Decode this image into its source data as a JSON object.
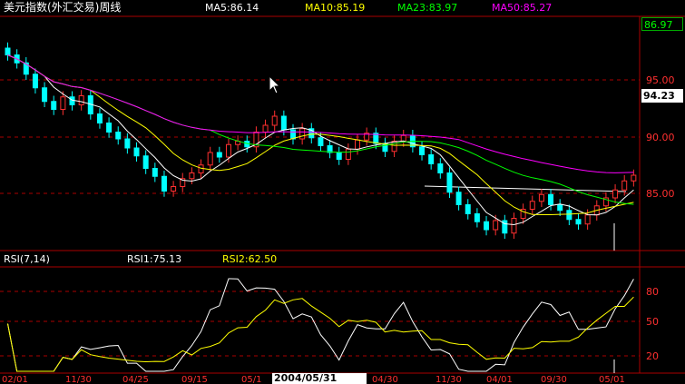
{
  "header": {
    "title": "美元指数(外汇交易)周线",
    "ma5": "MA5:86.14",
    "ma10": "MA10:85.19",
    "ma23": "MA23:83.97",
    "ma50": "MA50:85.27"
  },
  "price_axis": {
    "top_price": "86.97",
    "current_price": "94.23",
    "labels": [
      "95.00",
      "90.00",
      "85.00"
    ]
  },
  "rsi": {
    "label": "RSI(7,14)",
    "rsi1": "RSI1:75.13",
    "rsi2": "RSI2:62.50",
    "levels": [
      "80",
      "50",
      "20"
    ]
  },
  "date_axis": {
    "labels": [
      "02/01",
      "11/30",
      "04/25",
      "09/15",
      "05/1",
      "04/30",
      "11/30",
      "04/01",
      "09/30",
      "05/01"
    ],
    "highlight": "2004/05/31"
  },
  "colors": {
    "background": "#000000",
    "up_candle": "#ff3030",
    "down_candle": "#00ffff",
    "ma5": "#ffffff",
    "ma10": "#ffff00",
    "ma23": "#00ff00",
    "ma50": "#ff00ff",
    "grid": "#aa0000",
    "title_ma5": "#ffffff",
    "title_ma10": "#ffff00",
    "title_ma23": "#00ff00",
    "title_ma50": "#ff00ff"
  }
}
